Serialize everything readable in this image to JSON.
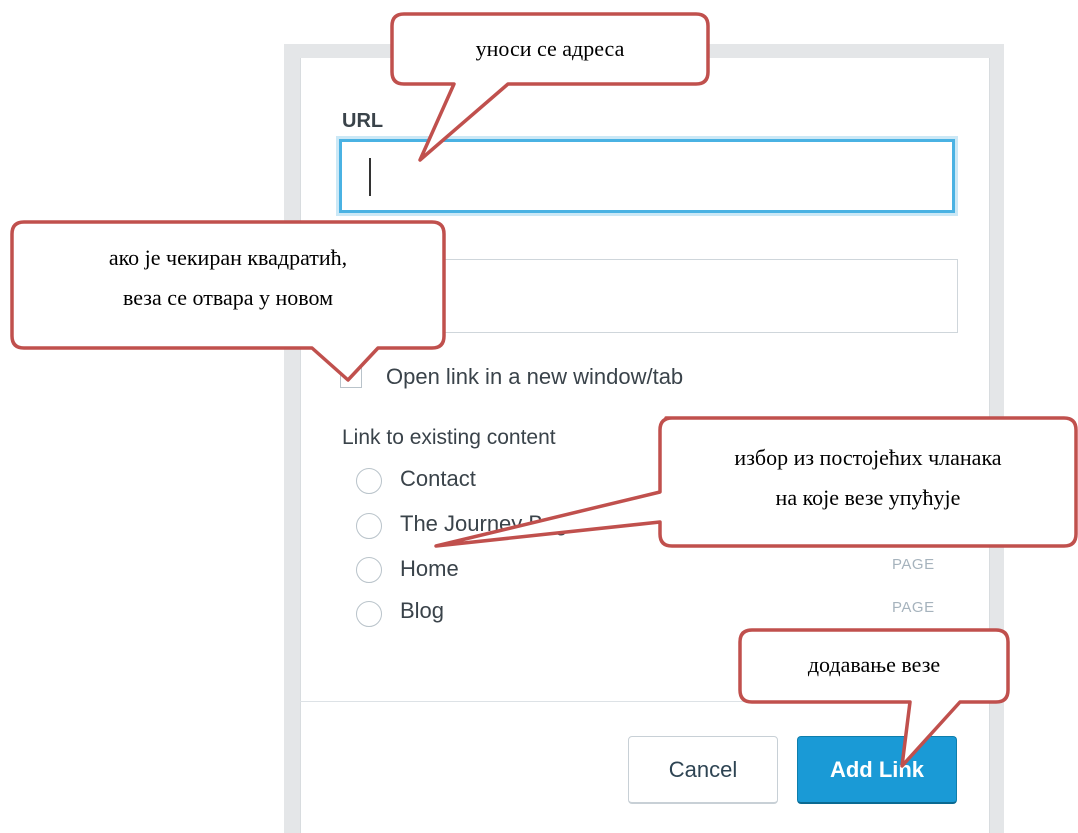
{
  "dialog": {
    "url_label": "URL",
    "url_value": "",
    "text_value": "",
    "new_window_label": "Open link in a new window/tab",
    "existing_content_label": "Link to existing content",
    "options": [
      {
        "label": "Contact",
        "type": ""
      },
      {
        "label": "The Journey Begins",
        "type": ""
      },
      {
        "label": "Home",
        "type": "PAGE"
      },
      {
        "label": "Blog",
        "type": "PAGE"
      }
    ],
    "cancel_label": "Cancel",
    "add_link_label": "Add Link"
  },
  "callouts": {
    "url": "уноси се адреса",
    "checkbox_line1": "ако је чекиран квадратић,",
    "checkbox_line2": "веза се отвара у новом",
    "existing_line1": "избор из постојећих чланака",
    "existing_line2": "на које везе упућује",
    "add": "додавање везе"
  },
  "colors": {
    "callout_border": "#c0504d",
    "accent": "#1a9ad6",
    "focus_border": "#4ab2e3"
  }
}
